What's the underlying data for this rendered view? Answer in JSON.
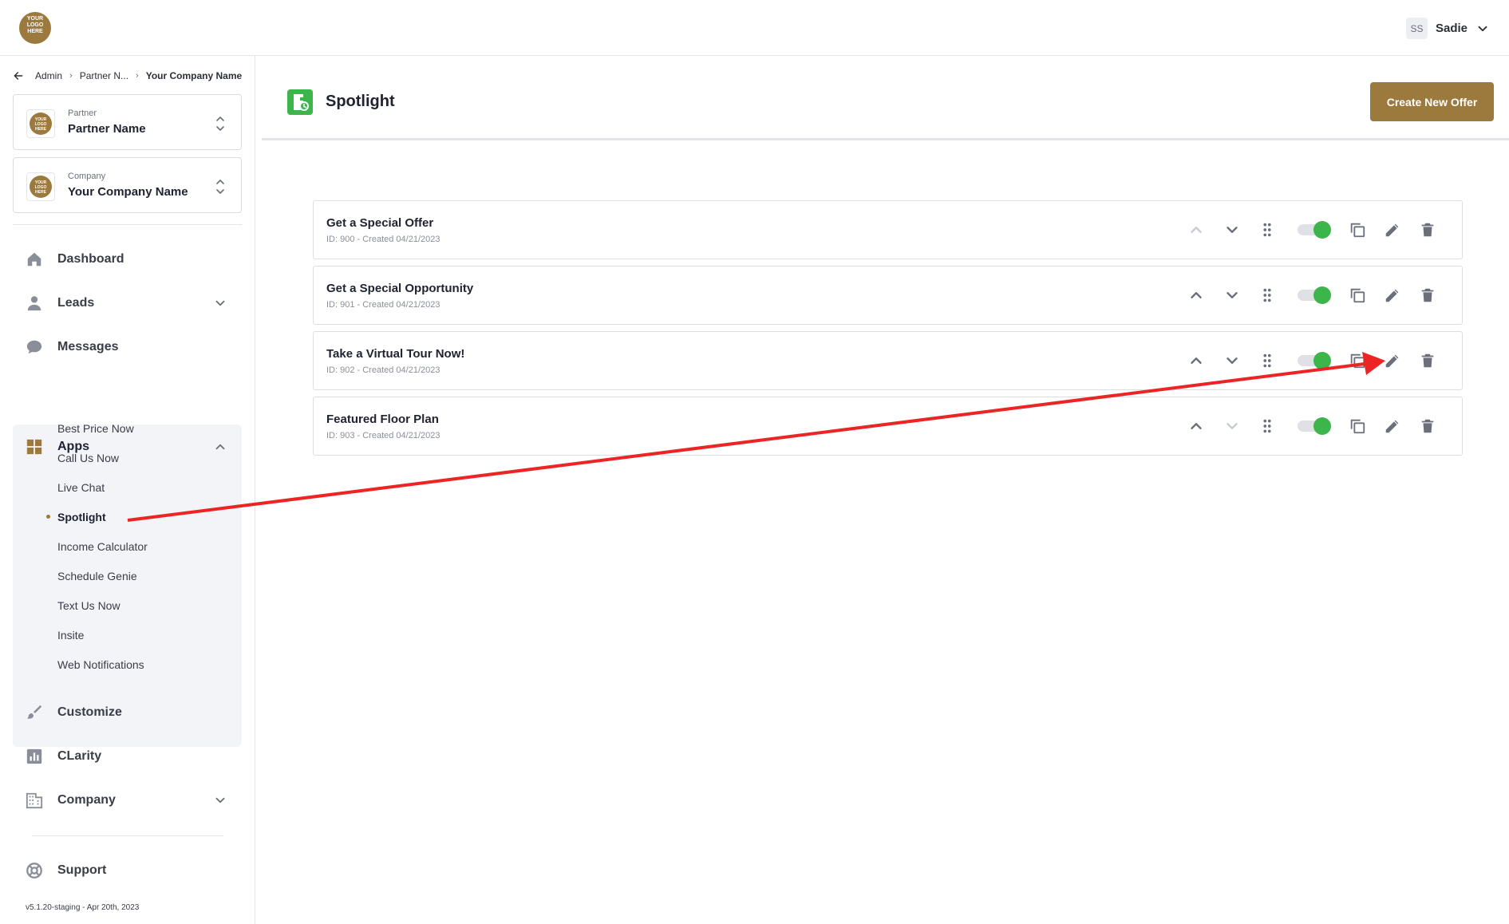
{
  "header": {
    "logo_text": "YOUR LOGO HERE",
    "user_initials": "SS",
    "user_name": "Sadie",
    "user_menu_icon": "chevron-down-icon"
  },
  "breadcrumb": {
    "back_icon": "arrow-left-icon",
    "items": [
      "Admin",
      "Partner N...",
      "Your Company Name"
    ]
  },
  "partner_selector": {
    "label": "Partner",
    "value": "Partner Name",
    "logo_text": "YOUR LOGO HERE"
  },
  "company_selector": {
    "label": "Company",
    "value": "Your Company Name",
    "logo_text": "YOUR LOGO HERE"
  },
  "nav": {
    "dashboard": "Dashboard",
    "leads": "Leads",
    "messages": "Messages",
    "apps": "Apps",
    "customize": "Customize",
    "clarity": "CLarity",
    "company": "Company",
    "support": "Support"
  },
  "apps_submenu": [
    "Best Price Now",
    "Call Us Now",
    "Live Chat",
    "Spotlight",
    "Income Calculator",
    "Schedule Genie",
    "Text Us Now",
    "Insite",
    "Web Notifications"
  ],
  "apps_active": "Spotlight",
  "version": "v5.1.20-staging - Apr 20th, 2023",
  "page": {
    "title": "Spotlight",
    "create_button": "Create New Offer"
  },
  "offers": [
    {
      "name": "Get a Special Offer",
      "meta": "ID: 900 - Created 04/21/2023",
      "enabled": true,
      "up_disabled": true,
      "down_disabled": false
    },
    {
      "name": "Get a Special Opportunity",
      "meta": "ID: 901 - Created 04/21/2023",
      "enabled": true,
      "up_disabled": false,
      "down_disabled": false
    },
    {
      "name": "Take a Virtual Tour Now!",
      "meta": "ID: 902 - Created 04/21/2023",
      "enabled": true,
      "up_disabled": false,
      "down_disabled": false
    },
    {
      "name": "Featured Floor Plan",
      "meta": "ID: 903 - Created 04/21/2023",
      "enabled": true,
      "up_disabled": false,
      "down_disabled": true
    }
  ],
  "colors": {
    "brand": "#9c7a3e",
    "toggle_on": "#3cb54a",
    "annotation_arrow": "#ec2424"
  }
}
